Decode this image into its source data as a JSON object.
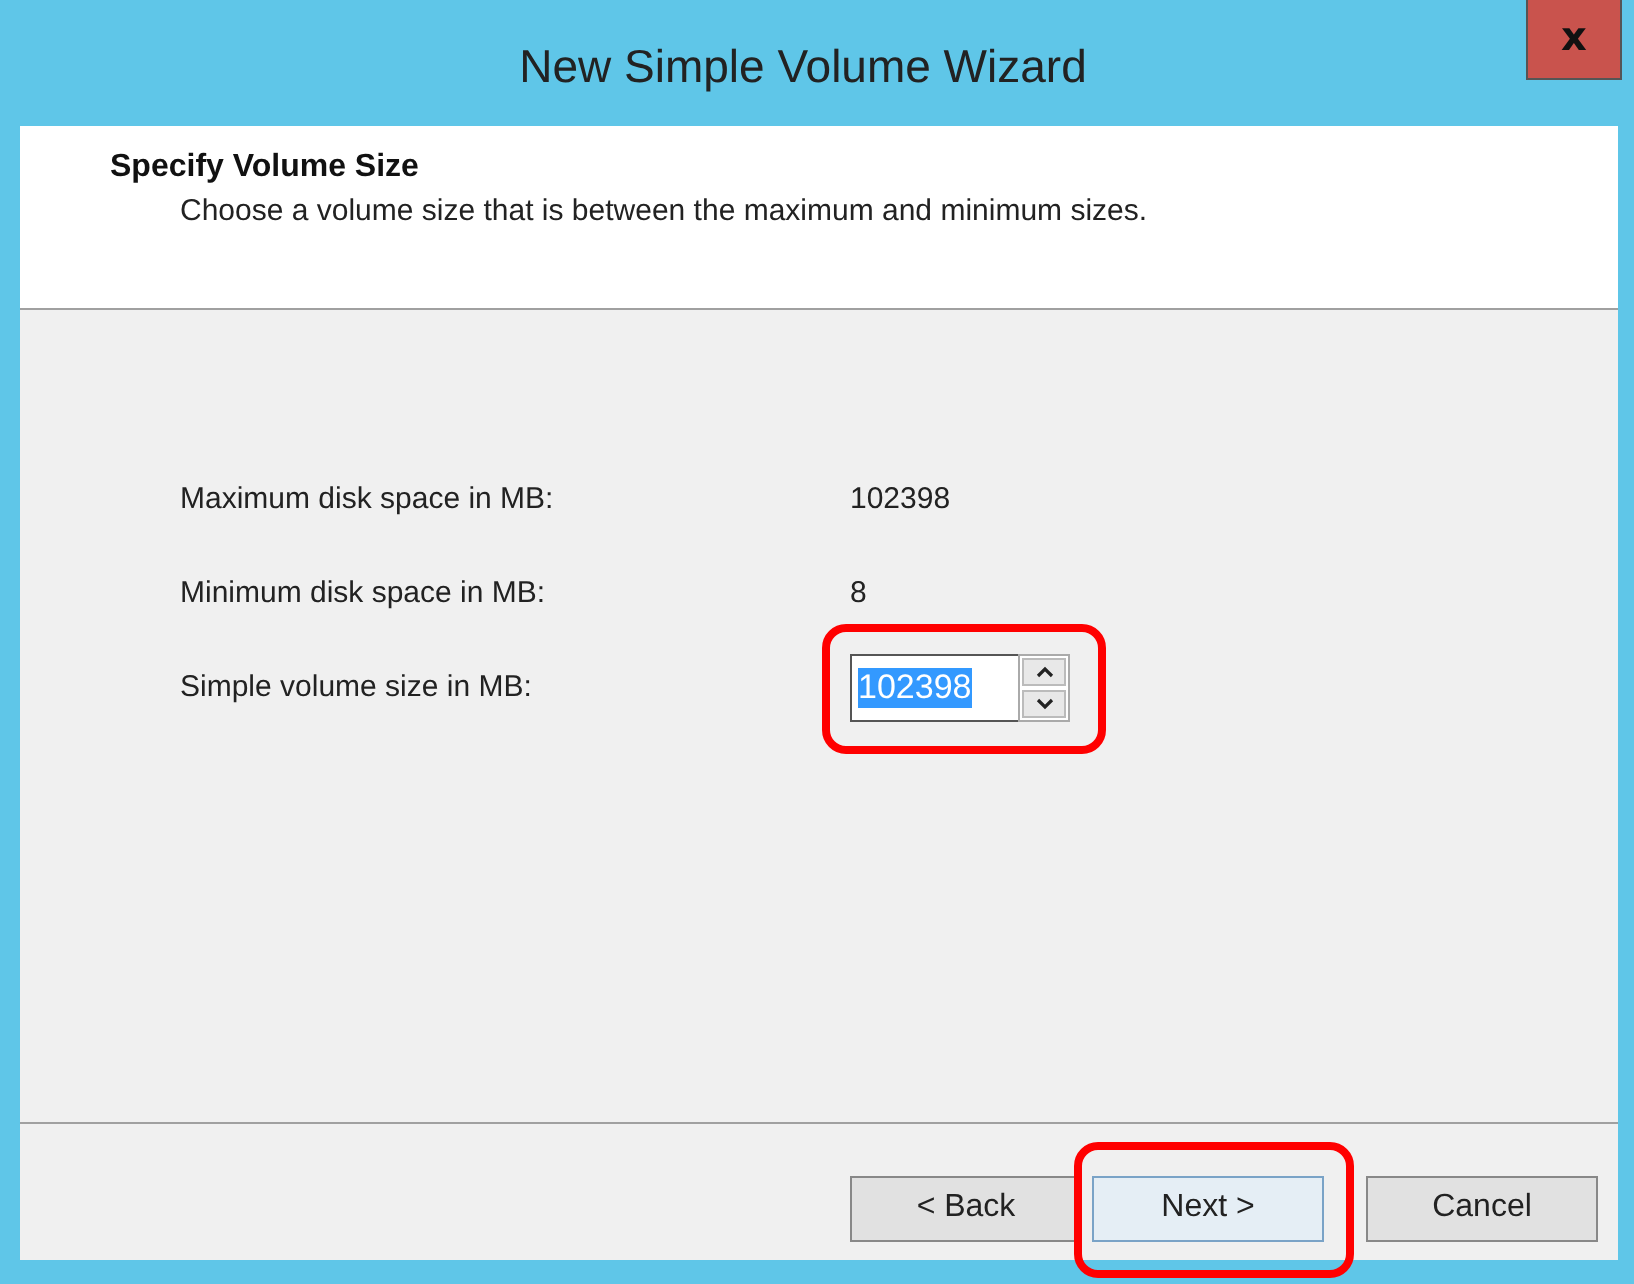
{
  "window": {
    "title": "New Simple Volume Wizard",
    "close": "x"
  },
  "header": {
    "title": "Specify Volume Size",
    "subtitle": "Choose a volume size that is between the maximum and minimum sizes."
  },
  "fields": [
    {
      "kind": "readout",
      "label": "Maximum disk space in MB:",
      "value": "102398"
    },
    {
      "kind": "readout",
      "label": "Minimum disk space in MB:",
      "value": "8"
    },
    {
      "kind": "spinner",
      "label": "Simple volume size in MB:",
      "value": "102398",
      "text_selected": true,
      "highlighted": true
    }
  ],
  "buttons": [
    {
      "label": "< Back",
      "default": false,
      "highlighted": false
    },
    {
      "label": "Next >",
      "default": true,
      "highlighted": true
    },
    {
      "label": "Cancel",
      "default": false,
      "highlighted": false
    }
  ]
}
